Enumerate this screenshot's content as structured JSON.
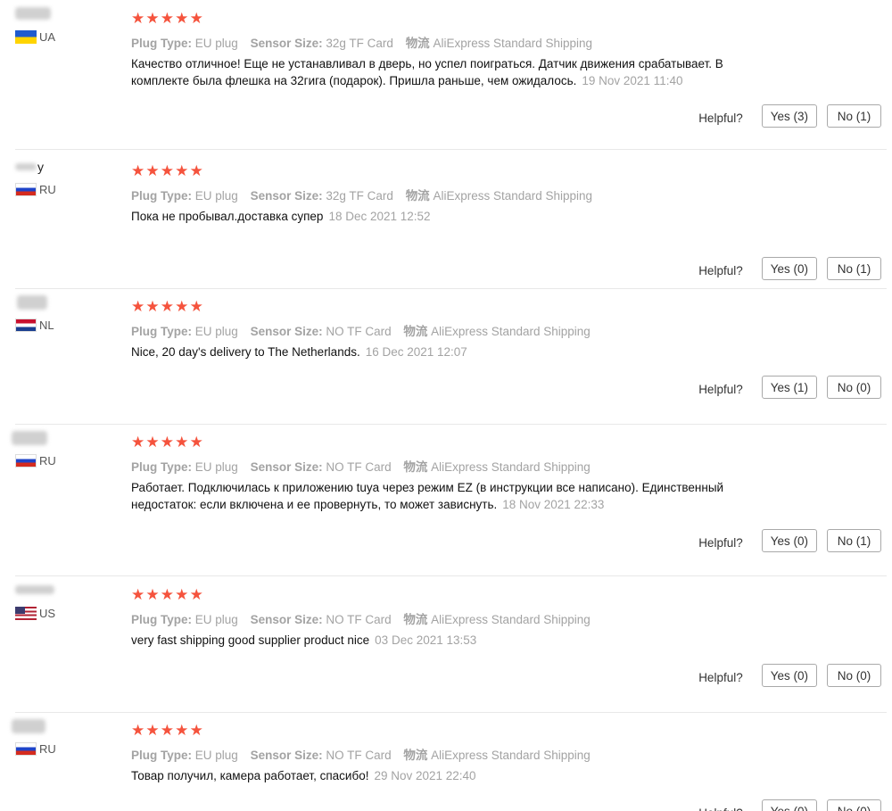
{
  "labels": {
    "plug_type": "Plug Type:",
    "sensor_size": "Sensor Size:",
    "shipping": "物流",
    "helpful": "Helpful?"
  },
  "reviews": [
    {
      "name_tail": "",
      "country": "UA",
      "flag": "ua",
      "rating": 5,
      "plug_type": "EU plug",
      "sensor_size": "32g TF Card",
      "shipping": "AliExpress Standard Shipping",
      "text": "Качество отличное! Еще не устанавливал в дверь, но успел поиграться. Датчик движения срабатывает. В комплекте была флешка на 32гига (подарок). Пришла раньше, чем ожидалось.",
      "date": "19 Nov 2021 11:40",
      "yes": "Yes (3)",
      "no": "No (1)"
    },
    {
      "name_tail": "y",
      "country": "RU",
      "flag": "ru",
      "rating": 5,
      "plug_type": "EU plug",
      "sensor_size": "32g TF Card",
      "shipping": "AliExpress Standard Shipping",
      "text": "Пока не пробывал.доставка супер",
      "date": "18 Dec 2021 12:52",
      "yes": "Yes (0)",
      "no": "No (1)"
    },
    {
      "name_tail": "",
      "country": "NL",
      "flag": "nl",
      "rating": 5,
      "plug_type": "EU plug",
      "sensor_size": "NO TF Card",
      "shipping": "AliExpress Standard Shipping",
      "text": "Nice, 20 day's delivery to The Netherlands.",
      "date": "16 Dec 2021 12:07",
      "yes": "Yes (1)",
      "no": "No (0)"
    },
    {
      "name_tail": "",
      "country": "RU",
      "flag": "ru",
      "rating": 5,
      "plug_type": "EU plug",
      "sensor_size": "NO TF Card",
      "shipping": "AliExpress Standard Shipping",
      "text": "Работает. Подключилась к приложению tuya через режим EZ (в инструкции все написано). Единственный недостаток: если включена и ее провернуть, то может зависнуть.",
      "date": "18 Nov 2021 22:33",
      "yes": "Yes (0)",
      "no": "No (1)"
    },
    {
      "name_tail": "",
      "country": "US",
      "flag": "us",
      "rating": 5,
      "plug_type": "EU plug",
      "sensor_size": "NO TF Card",
      "shipping": "AliExpress Standard Shipping",
      "text": "very fast shipping good supplier product nice",
      "date": "03 Dec 2021 13:53",
      "yes": "Yes (0)",
      "no": "No (0)"
    },
    {
      "name_tail": "",
      "country": "RU",
      "flag": "ru",
      "rating": 5,
      "plug_type": "EU plug",
      "sensor_size": "NO TF Card",
      "shipping": "AliExpress Standard Shipping",
      "text": "Товар получил, камера работает, спасибо!",
      "date": "29 Nov 2021 22:40",
      "yes": "Yes (0)",
      "no": "No (0)"
    }
  ]
}
